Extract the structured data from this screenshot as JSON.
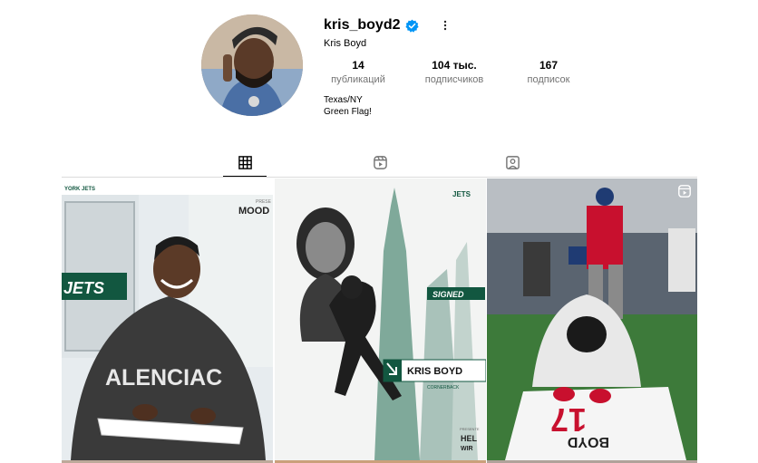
{
  "profile": {
    "username": "kris_boyd2",
    "full_name": "Kris Boyd",
    "verified": true,
    "bio_lines": [
      "Texas/NY",
      "Green Flag!"
    ]
  },
  "stats": {
    "posts": {
      "value": "14",
      "label": "публикаций"
    },
    "followers": {
      "value": "104 тыс.",
      "label": "подписчиков"
    },
    "following": {
      "value": "167",
      "label": "подписок"
    }
  },
  "tabs": [
    {
      "id": "posts",
      "icon": "grid-icon",
      "active": true
    },
    {
      "id": "reels",
      "icon": "reels-icon",
      "active": false
    },
    {
      "id": "tagged",
      "icon": "tagged-icon",
      "active": false
    }
  ],
  "posts": [
    {
      "tile_text": [
        "YORK JETS",
        "PRESE",
        "MOOD",
        "JETS",
        "ALENCIAC"
      ],
      "type": "image"
    },
    {
      "tile_text": [
        "JETS",
        "SIGNED",
        "KRIS BOYD",
        "CORNERBACK",
        "PRESENTE",
        "HEL",
        "WIR"
      ],
      "type": "image"
    },
    {
      "tile_text": [
        "17",
        "BOYD"
      ],
      "type": "reel"
    }
  ],
  "colors": {
    "verified_blue": "#0095f6",
    "jets_green": "#125740",
    "secondary_text": "#737373",
    "divider": "#dbdbdb"
  }
}
